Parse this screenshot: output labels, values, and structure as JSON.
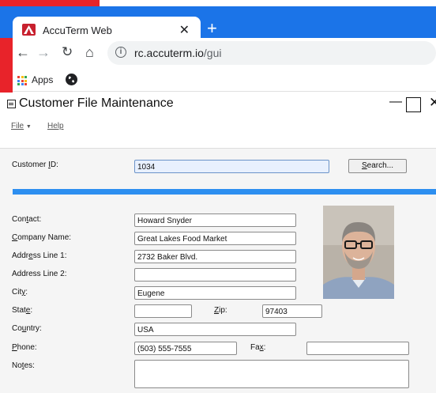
{
  "browser": {
    "tab_title": "AccuTerm Web",
    "url_host": "rc.accuterm.io",
    "url_path": "/gui",
    "bookmark_apps": "Apps"
  },
  "window": {
    "title": "Customer File Maintenance"
  },
  "menu": {
    "file": "File",
    "help": "Help"
  },
  "form": {
    "customer_id_label_pre": "Customer ",
    "customer_id_label_u": "I",
    "customer_id_label_post": "D:",
    "customer_id": "1034",
    "search_button_u": "S",
    "search_button_rest": "earch...",
    "contact_label_pre": "Con",
    "contact_label_u": "t",
    "contact_label_post": "act:",
    "contact": "Howard Snyder",
    "company_label_u": "C",
    "company_label_post": "ompany Name:",
    "company": "Great Lakes Food Market",
    "addr1_label_pre": "Addr",
    "addr1_label_u": "e",
    "addr1_label_post": "ss Line 1:",
    "addr1": "2732 Baker Blvd.",
    "addr2_label": "Address Line 2:",
    "addr2": "",
    "city_label_pre": "Cit",
    "city_label_u": "y",
    "city_label_post": ":",
    "city": "Eugene",
    "state_label_pre": "Stat",
    "state_label_u": "e",
    "state_label_post": ":",
    "state": "",
    "zip_label_u": "Z",
    "zip_label_post": "ip:",
    "zip": "97403",
    "country_label_pre": "Co",
    "country_label_u": "u",
    "country_label_post": "ntry:",
    "country": "USA",
    "phone_label_u": "P",
    "phone_label_post": "hone:",
    "phone": "(503) 555-7555",
    "fax_label_pre": "Fa",
    "fax_label_u": "x",
    "fax_label_post": ":",
    "fax": "",
    "notes_label_pre": "No",
    "notes_label_u": "t",
    "notes_label_post": "es:",
    "notes": ""
  },
  "colors": {
    "chrome_blue": "#1b74e8",
    "accent_bar": "#2d8ff0",
    "favicon_red": "#c8202e"
  },
  "icons": {
    "favicon": "accuterm-logo",
    "back": "back-arrow-icon",
    "forward": "forward-arrow-icon",
    "reload": "reload-icon",
    "home": "home-icon",
    "info": "info-icon",
    "apps": "apps-grid-icon",
    "globe": "globe-icon"
  }
}
